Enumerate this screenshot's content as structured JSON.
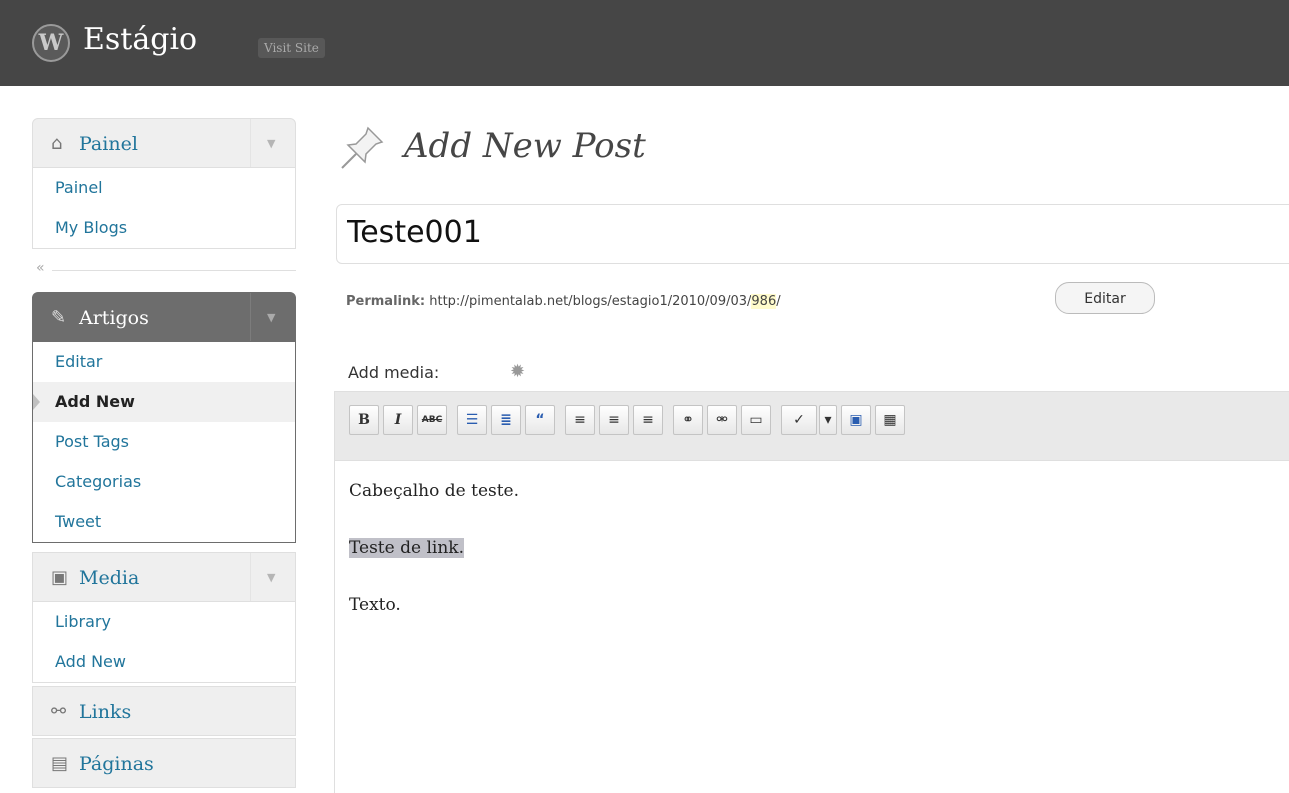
{
  "header": {
    "site_name": "Estágio",
    "visit_site": "Visit Site"
  },
  "sidebar": {
    "painel": {
      "label": "Painel",
      "items": [
        "Painel",
        "My Blogs"
      ]
    },
    "collapse": "«",
    "artigos": {
      "label": "Artigos",
      "items": [
        "Editar",
        "Add New",
        "Post Tags",
        "Categorias",
        "Tweet"
      ],
      "current": "Add New"
    },
    "media": {
      "label": "Media",
      "items": [
        "Library",
        "Add New"
      ]
    },
    "links": {
      "label": "Links"
    },
    "paginas": {
      "label": "Páginas"
    }
  },
  "main": {
    "page_title": "Add New Post",
    "post_title": "Teste001",
    "permalink": {
      "label": "Permalink:",
      "url_prefix": "http://pimentalab.net/blogs/estagio1/2010/09/03/",
      "slug": "986",
      "url_suffix": "/",
      "edit_button": "Editar"
    },
    "add_media_label": "Add media:",
    "editor": {
      "toolbar": [
        "bold-icon",
        "italic-icon",
        "strikethrough-icon",
        "bullet-list-icon",
        "numbered-list-icon",
        "blockquote-icon",
        "align-left-icon",
        "align-center-icon",
        "align-right-icon",
        "link-icon",
        "unlink-icon",
        "more-tag-icon",
        "spellcheck-icon",
        "dropdown-icon",
        "fullscreen-icon",
        "kitchen-sink-icon"
      ],
      "paragraphs": [
        "Cabeçalho de teste.",
        "Teste de link.",
        "Texto."
      ]
    }
  }
}
